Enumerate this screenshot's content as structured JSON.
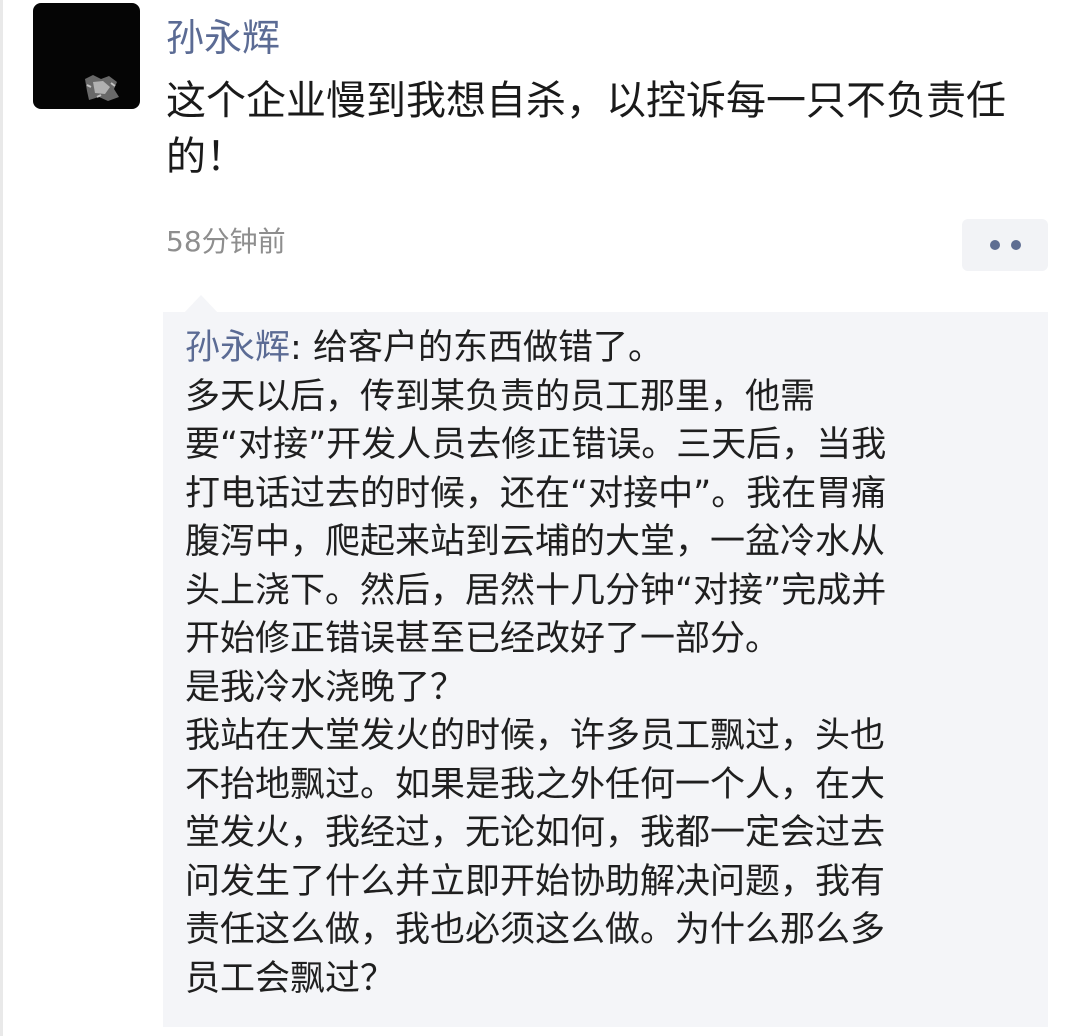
{
  "post": {
    "author": "孙永辉",
    "text": "这个企业慢到我想自杀，以控诉每一只不负责任的！",
    "time": "58分钟前"
  },
  "icons": {
    "avatar": "avatar-image",
    "more": "more-dots-icon"
  },
  "comment": {
    "author": "孙永辉",
    "separator": ": ",
    "lines": [
      "给客户的东西做错了。",
      "多天以后，传到某负责的员工那里，他需",
      "要“对接”开发人员去修正错误。三天后，当我",
      "打电话过去的时候，还在“对接中”。我在胃痛",
      "腹泻中，爬起来站到云埔的大堂，一盆冷水从",
      "头上浇下。然后，居然十几分钟“对接”完成并",
      "开始修正错误甚至已经改好了一部分。",
      "是我冷水浇晚了？",
      "我站在大堂发火的时候，许多员工飘过，头也",
      "不抬地飘过。如果是我之外任何一个人，在大",
      "堂发火，我经过，无论如何，我都一定会过去",
      "问发生了什么并立即开始协助解决问题，我有",
      "责任这么做，我也必须这么做。为什么那么多",
      "员工会飘过？"
    ]
  },
  "colors": {
    "name_link": "#5b6b94",
    "text": "#1a1a1a",
    "time": "#8e8e8e",
    "comment_bg": "#f4f5f8"
  }
}
